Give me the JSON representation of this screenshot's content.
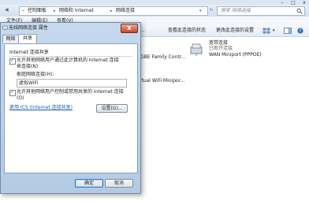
{
  "explorer": {
    "breadcrumb": [
      "控制面板",
      "网络和 Internet",
      "网络连接"
    ],
    "search_placeholder": "搜索 网络连接",
    "menu": [
      "文件(F)",
      "编辑(E)",
      "查看(V)"
    ],
    "toolbar": [
      "查看此连接的状态",
      "更改此连接的设置"
    ],
    "connections": [
      {
        "name_partial": "GBE Family Contr..."
      },
      {
        "name": "宽带连接",
        "status": "已断开连接",
        "device": "WAN Miniport (PPPOE)"
      },
      {
        "name_partial": "rtual WiFi Minipor..."
      }
    ]
  },
  "dialog": {
    "title": "无线网络连接 属性",
    "close_label": "X",
    "tabs": [
      "网络",
      "共享"
    ],
    "active_tab": "共享",
    "section_title": "Internet 连接共享",
    "allow_share": {
      "checked": true,
      "line1": "允许其他网络用户通过此计算机的 Internet 连接",
      "line2": "来连接(N)"
    },
    "home_network_label": "家庭网络连接(H):",
    "home_network_value": "虚拟WiFi",
    "allow_control": {
      "checked": true,
      "line1": "允许其他网络用户控制或禁用共享的 Internet 连接",
      "line2": "(O)"
    },
    "help_link": "使用 ICS (Internet 连接共享)",
    "settings_button": "设置(G)...",
    "ok_button": "确定",
    "cancel_button": "取消"
  }
}
